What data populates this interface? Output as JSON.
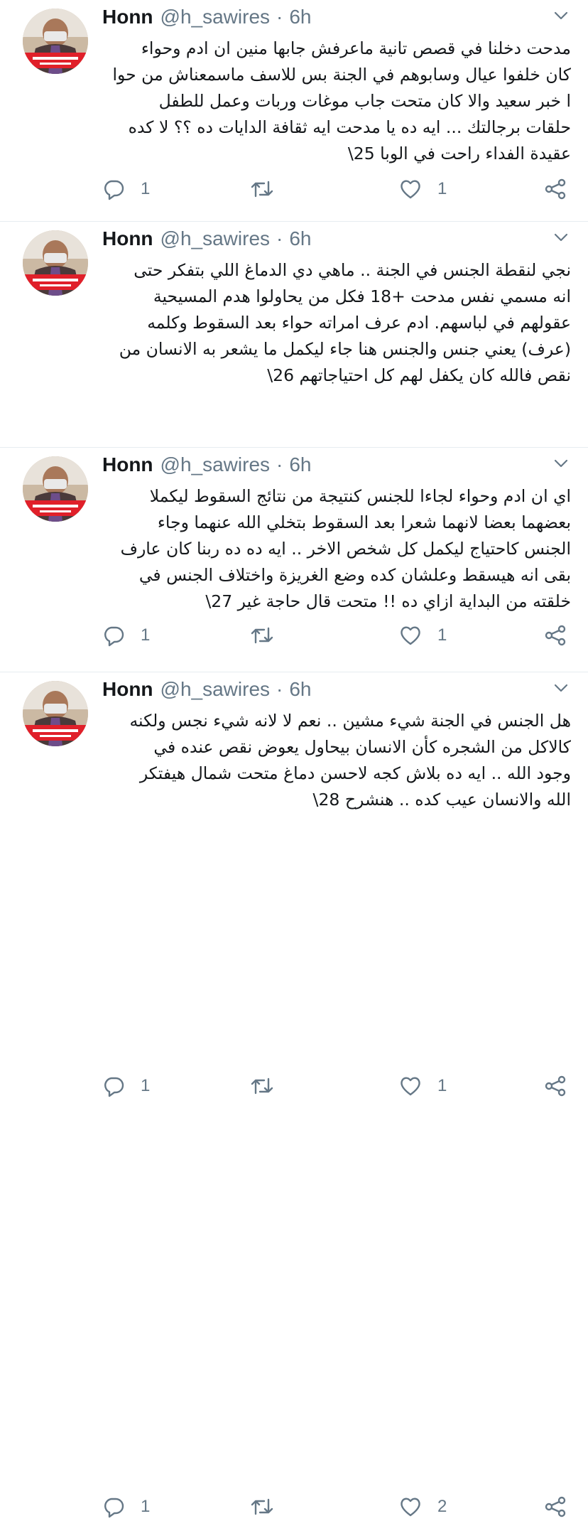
{
  "tweets": [
    {
      "name": "Honn",
      "handle": "@h_sawires",
      "separator": "·",
      "time": "6h",
      "text": "مدحت دخلنا في قصص تانية ماعرفش جابها منين ان ادم وحواء\nكان خلفوا عيال وسابوهم في الجنة بس للاسف ماسمعناش من حوا\nا خبر سعيد والا كان متحت جاب موغات وربات وعمل للطفل\nحلقات برجالتك ... ايه ده يا مدحت ايه ثقافة الدايات ده ؟؟ لا كده\nعقيدة الفداء راحت في الوبا 25\\",
      "reply_count": "1",
      "retweet_count": "",
      "like_count": "1"
    },
    {
      "name": "Honn",
      "handle": "@h_sawires",
      "separator": "·",
      "time": "6h",
      "text": "نجي لنقطة الجنس في الجنة .. ماهي دي الدماغ اللي بتفكر حتى\nانه مسمي نفس مدحت +18 فكل من يحاولوا هدم المسيحية\nعقولهم في لباسهم. ادم عرف امراته حواء بعد السقوط وكلمه\n(عرف) يعني جنس والجنس هنا جاء ليكمل ما يشعر به الانسان من\nنقص فالله كان يكفل لهم كل احتياجاتهم 26\\",
      "reply_count": "1",
      "retweet_count": "",
      "like_count": "1"
    },
    {
      "name": "Honn",
      "handle": "@h_sawires",
      "separator": "·",
      "time": "6h",
      "text": "اي ان ادم وحواء لجاءا للجنس كنتيجة من نتائج السقوط ليكملا\nبعضهما بعضا لانهما شعرا بعد السقوط بتخلي الله عنهما وجاء\nالجنس كاحتياج ليكمل كل شخص الاخر .. ايه ده ده ربنا كان عارف\nبقى انه هيسقط وعلشان كده وضع الغريزة واختلاف الجنس في\nخلقته من البداية ازاي ده !! متحت قال حاجة غير 27\\",
      "reply_count": "1",
      "retweet_count": "",
      "like_count": "1"
    },
    {
      "name": "Honn",
      "handle": "@h_sawires",
      "separator": "·",
      "time": "6h",
      "text": "هل الجنس في الجنة شيء مشين .. نعم لا لانه شيء نجس ولكنه\nكالاكل من الشجره كأن الانسان بيحاول يعوض نقص عنده في\nوجود الله .. ايه ده بلاش كجه لاحسن دماغ متحت شمال هيفتكر\nالله والانسان عيب كده .. هنشرح 28\\",
      "reply_count": "1",
      "retweet_count": "",
      "like_count": "2"
    }
  ],
  "colors": {
    "text": "#14171a",
    "muted": "#657786",
    "divider": "#e6ecf0",
    "avatar_banner": "#e0202a"
  },
  "icons": [
    "reply-icon",
    "retweet-icon",
    "like-icon",
    "share-icon",
    "chevron-down-icon"
  ]
}
